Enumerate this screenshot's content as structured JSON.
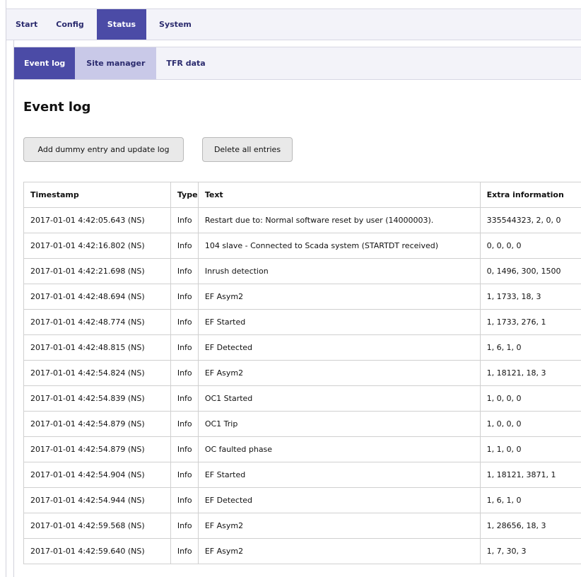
{
  "topnav": {
    "tabs": [
      "Start",
      "Config",
      "Status",
      "System"
    ],
    "active": "Status"
  },
  "subnav": {
    "tabs": [
      "Event log",
      "Site manager",
      "TFR data"
    ],
    "active": "Event log",
    "hover": "Site manager"
  },
  "page": {
    "title": "Event log"
  },
  "buttons": {
    "add_label": "Add dummy entry and update log",
    "delete_label": "Delete all entries"
  },
  "table": {
    "headers": [
      "Timestamp",
      "Type",
      "Text",
      "Extra information"
    ],
    "rows": [
      [
        "2017-01-01 4:42:05.643 (NS)",
        "Info",
        "Restart due to: Normal software reset by user (14000003).",
        "335544323, 2, 0, 0"
      ],
      [
        "2017-01-01 4:42:16.802 (NS)",
        "Info",
        "104 slave - Connected to Scada system (STARTDT received)",
        "0, 0, 0, 0"
      ],
      [
        "2017-01-01 4:42:21.698 (NS)",
        "Info",
        "Inrush detection",
        "0, 1496, 300, 1500"
      ],
      [
        "2017-01-01 4:42:48.694 (NS)",
        "Info",
        "EF Asym2",
        "1, 1733, 18, 3"
      ],
      [
        "2017-01-01 4:42:48.774 (NS)",
        "Info",
        "EF Started",
        "1, 1733, 276, 1"
      ],
      [
        "2017-01-01 4:42:48.815 (NS)",
        "Info",
        "EF Detected",
        "1, 6, 1, 0"
      ],
      [
        "2017-01-01 4:42:54.824 (NS)",
        "Info",
        "EF Asym2",
        "1, 18121, 18, 3"
      ],
      [
        "2017-01-01 4:42:54.839 (NS)",
        "Info",
        "OC1 Started",
        "1, 0, 0, 0"
      ],
      [
        "2017-01-01 4:42:54.879 (NS)",
        "Info",
        "OC1 Trip",
        "1, 0, 0, 0"
      ],
      [
        "2017-01-01 4:42:54.879 (NS)",
        "Info",
        "OC faulted phase",
        "1, 1, 0, 0"
      ],
      [
        "2017-01-01 4:42:54.904 (NS)",
        "Info",
        "EF Started",
        "1, 18121, 3871, 1"
      ],
      [
        "2017-01-01 4:42:54.944 (NS)",
        "Info",
        "EF Detected",
        "1, 6, 1, 0"
      ],
      [
        "2017-01-01 4:42:59.568 (NS)",
        "Info",
        "EF Asym2",
        "1, 28656, 18, 3"
      ],
      [
        "2017-01-01 4:42:59.640 (NS)",
        "Info",
        "EF Asym2",
        "1, 7, 30, 3"
      ]
    ]
  }
}
